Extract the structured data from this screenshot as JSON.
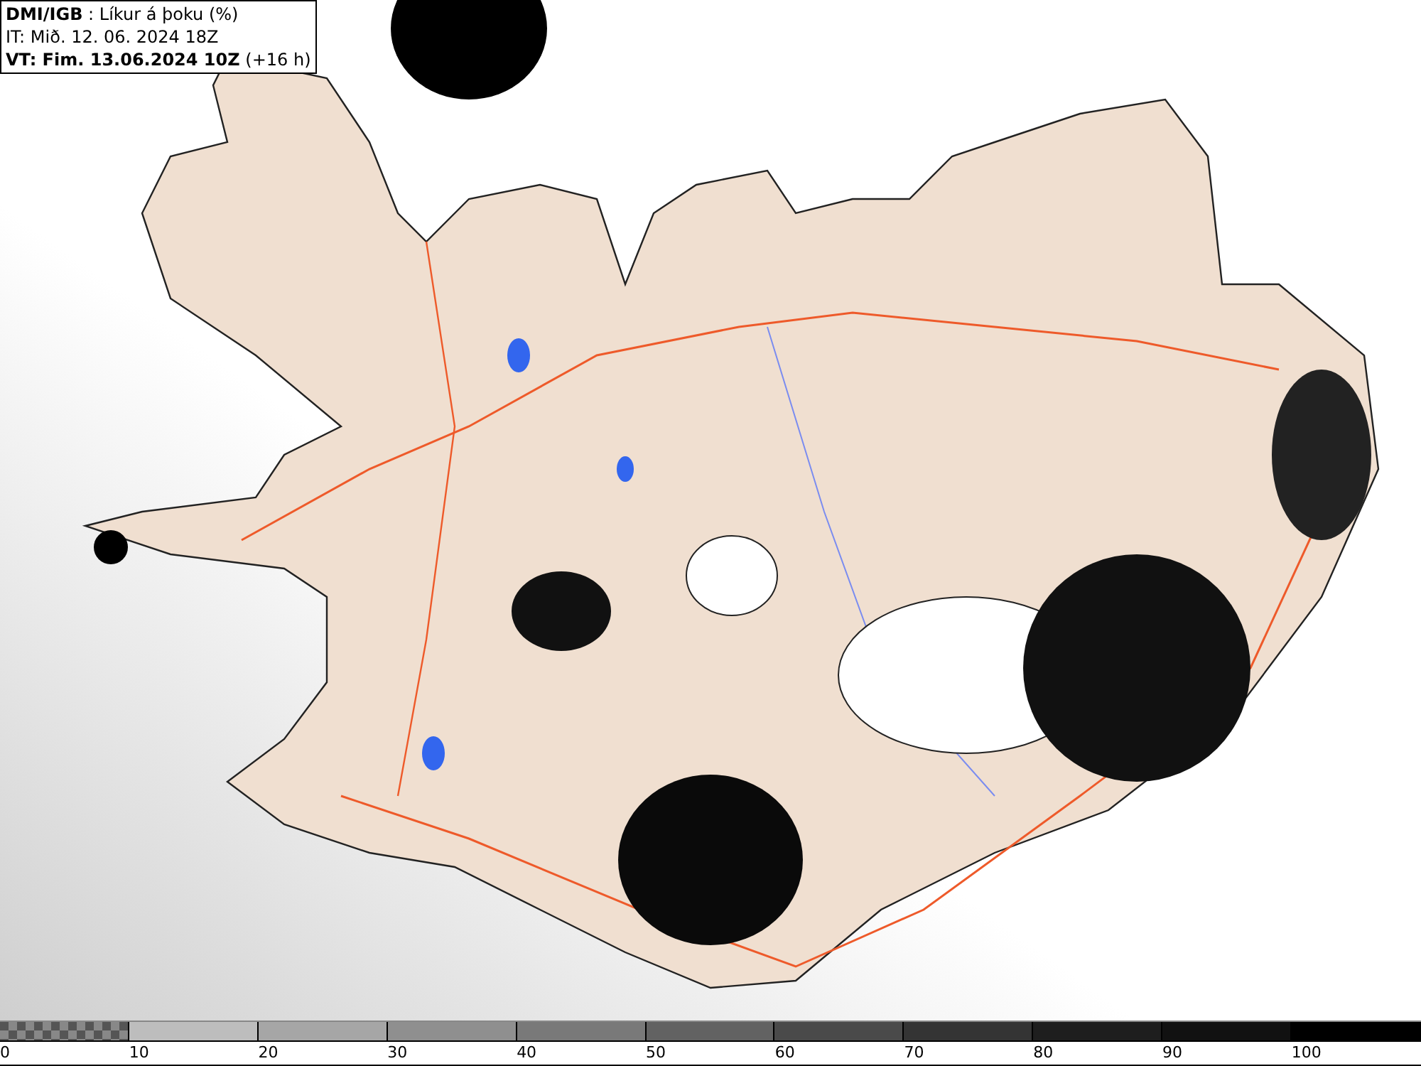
{
  "header": {
    "title": "**DMI/IGB** : Líkur á þoku (%)",
    "issue_time": "IT: Mið. 12. 06. 2024 18Z",
    "valid_time": "**VT: Fim. 13.06.2024 10Z** (+16 h)"
  },
  "legend": {
    "bins": [
      {
        "kind": "checker"
      },
      {
        "kind": "solid",
        "color": "#bdbdbd"
      },
      {
        "kind": "solid",
        "color": "#a6a6a6"
      },
      {
        "kind": "solid",
        "color": "#8f8f8f"
      },
      {
        "kind": "solid",
        "color": "#797979"
      },
      {
        "kind": "solid",
        "color": "#626262"
      },
      {
        "kind": "solid",
        "color": "#4a4a4a"
      },
      {
        "kind": "solid",
        "color": "#343434"
      },
      {
        "kind": "solid",
        "color": "#1e1e1e"
      },
      {
        "kind": "solid",
        "color": "#111111"
      },
      {
        "kind": "solid",
        "color": "#000000"
      }
    ],
    "labels": [
      "0",
      "10",
      "20",
      "30",
      "40",
      "50",
      "60",
      "70",
      "80",
      "90",
      "100"
    ]
  }
}
